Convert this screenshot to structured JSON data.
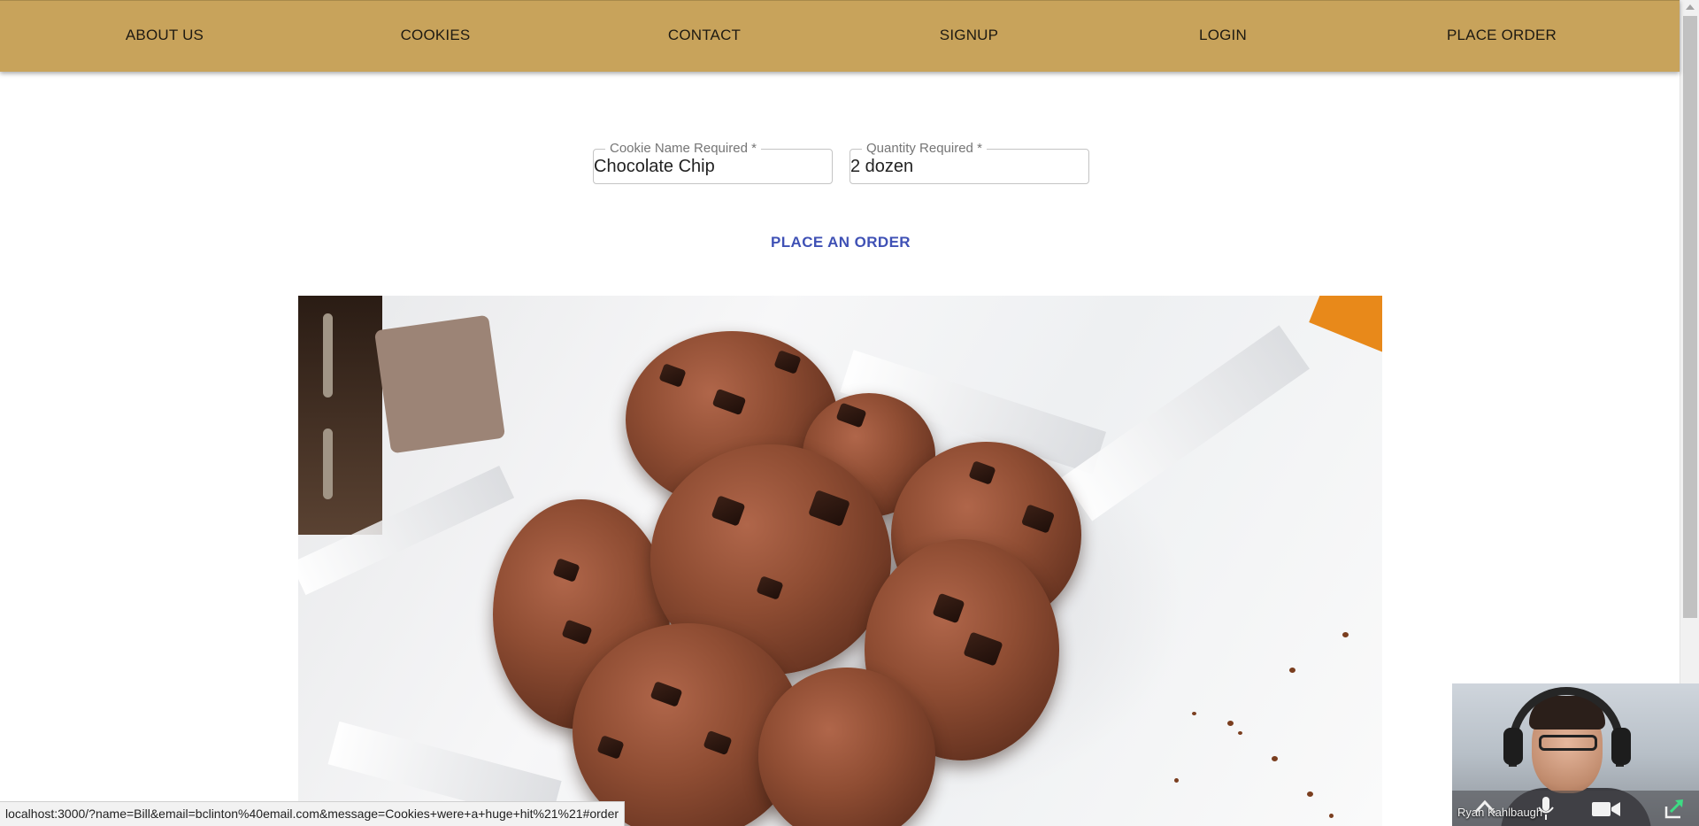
{
  "nav": {
    "items": [
      {
        "label": "ABOUT US"
      },
      {
        "label": "COOKIES"
      },
      {
        "label": "CONTACT"
      },
      {
        "label": "SIGNUP"
      },
      {
        "label": "LOGIN"
      },
      {
        "label": "PLACE ORDER"
      }
    ]
  },
  "form": {
    "cookie_name": {
      "label": "Cookie Name Required *",
      "value": "Chocolate Chip"
    },
    "quantity": {
      "label": "Quantity Required *",
      "value": "2 dozen"
    },
    "submit_label": "PLACE AN ORDER"
  },
  "hero": {
    "icon": "chocolate-cookies-photo"
  },
  "status_bar": {
    "url": "localhost:3000/?name=Bill&email=bclinton%40email.com&message=Cookies+were+a+huge+hit%21%21#order"
  },
  "video_call": {
    "participant_name": "Ryan Kahlbaugh",
    "icons": [
      "chevron-up-icon",
      "microphone-icon",
      "camera-icon",
      "share-icon"
    ]
  },
  "colors": {
    "nav_background": "#c8a35b",
    "button_text": "#3f51b5",
    "field_border": "#c4c4c4"
  }
}
